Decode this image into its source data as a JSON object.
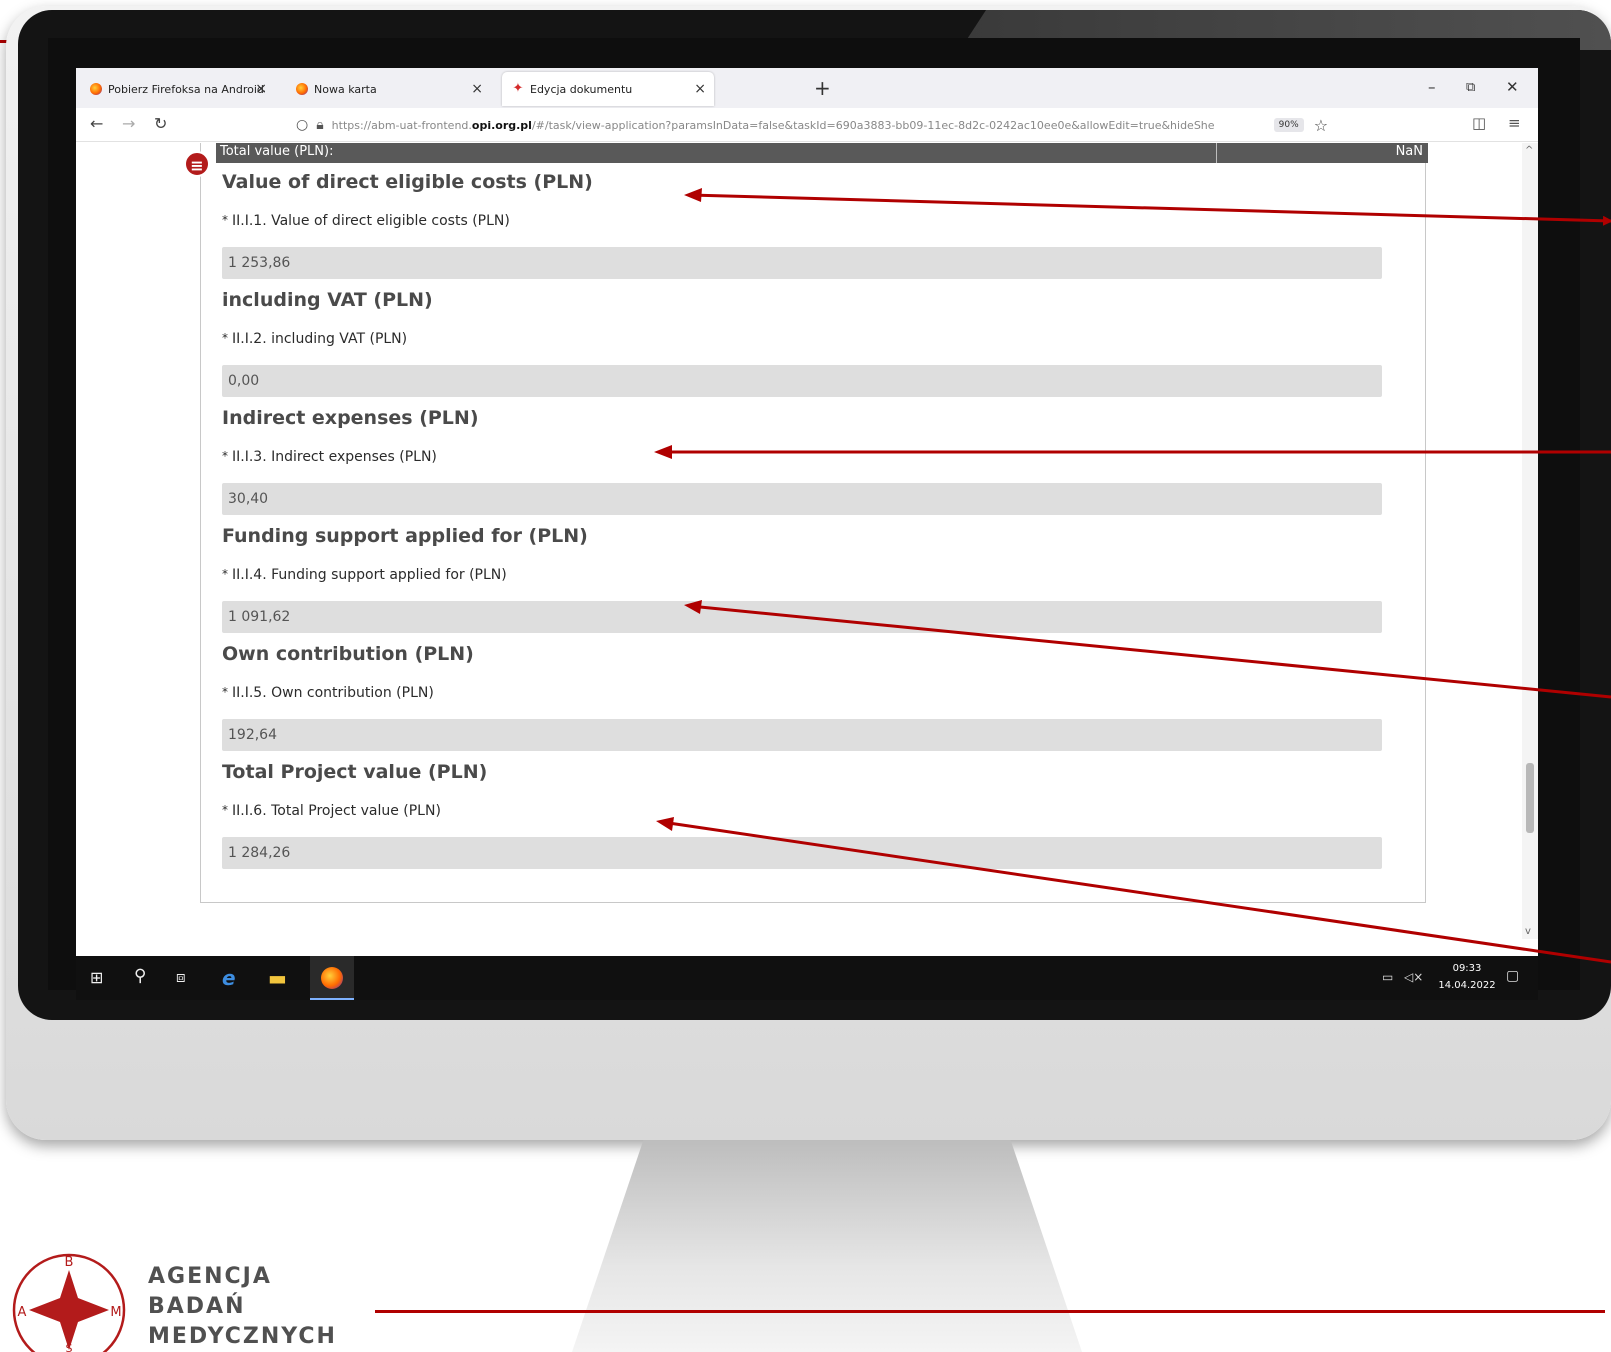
{
  "browser": {
    "tabs": [
      {
        "label": "Pobierz Firefoksa na Androida i",
        "icon": "firefox-icon",
        "active": false
      },
      {
        "label": "Nowa karta",
        "icon": "firefox-icon",
        "active": false
      },
      {
        "label": "Edycja dokumentu",
        "icon": "document-icon",
        "active": true
      }
    ],
    "new_tab": "+",
    "window_controls": {
      "minimize": "–",
      "restore": "⧉",
      "close": "✕"
    },
    "url_prefix": "https://abm-uat-frontend.",
    "url_domain": "opi.org.pl",
    "url_suffix": "/#/task/view-application?paramsInData=false&taskId=690a3883-bb09-11ec-8d2c-0242ac10ee0e&allowEdit=true&hideShe",
    "zoom": "90%"
  },
  "form": {
    "total_row": {
      "label": "Total value (PLN):",
      "value": "NaN"
    },
    "sections": [
      {
        "title": "Value of direct eligible costs (PLN)",
        "field_label": "II.I.1. Value of direct eligible costs (PLN)",
        "value": "1 253,86"
      },
      {
        "title": "including VAT (PLN)",
        "field_label": "II.I.2. including VAT (PLN)",
        "value": "0,00"
      },
      {
        "title": "Indirect expenses (PLN)",
        "field_label": "II.I.3. Indirect expenses (PLN)",
        "value": "30,40"
      },
      {
        "title": "Funding support applied for (PLN)",
        "field_label": "II.I.4. Funding support applied for (PLN)",
        "value": "1 091,62"
      },
      {
        "title": "Own contribution (PLN)",
        "field_label": "II.I.5. Own contribution (PLN)",
        "value": "192,64"
      },
      {
        "title": "Total Project value (PLN)",
        "field_label": "II.I.6. Total Project value (PLN)",
        "value": "1 284,26"
      }
    ],
    "required_marker": "*"
  },
  "taskbar": {
    "time": "09:33",
    "date": "14.04.2022"
  },
  "logo": {
    "line1": "AGENCJA",
    "line2": "BADAŃ",
    "line3": "MEDYCZNYCH",
    "emblem_letters": [
      "B",
      "A",
      "M",
      "Ś"
    ]
  },
  "colors": {
    "accent_red": "#b00000",
    "field_bg": "#dedede",
    "total_row_bg": "#595959"
  }
}
